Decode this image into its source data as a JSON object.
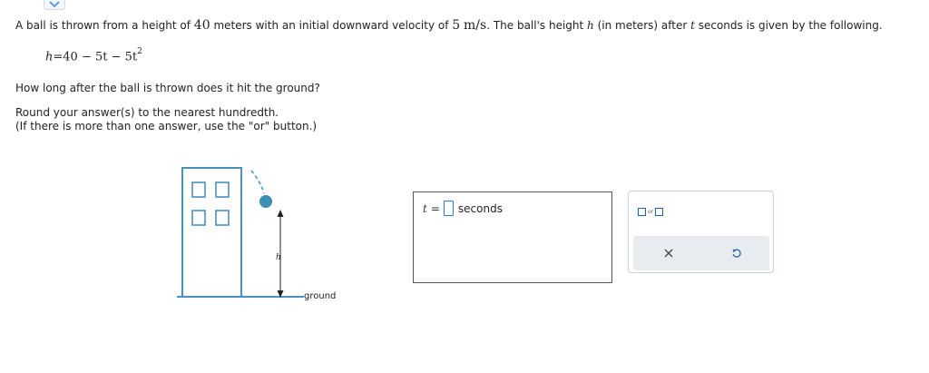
{
  "problem": {
    "intro_1": "A ball is thrown from a height of ",
    "height_value": "40",
    "intro_2": " meters with an initial downward velocity of ",
    "velocity_value": "5",
    "velocity_unit": "m/s",
    "intro_3": ". The ball's height ",
    "h_var": "h",
    "intro_4": " (in meters) after ",
    "t_var": "t",
    "intro_5": " seconds is given by the following."
  },
  "formula": {
    "lhs": "h",
    "rhs": "=40 − 5t − 5t",
    "exponent": "2"
  },
  "question": "How long after the ball is thrown does it hit the ground?",
  "instructions": {
    "line1": "Round your answer(s) to the nearest hundredth.",
    "line2": "(If there is more than one answer, use the \"or\" button.)"
  },
  "diagram": {
    "h_label": "h",
    "ground_label": "ground"
  },
  "answer": {
    "variable": "t",
    "equals": "=",
    "value": "",
    "units": "seconds"
  },
  "tools": {
    "or_label": "or"
  },
  "colors": {
    "building": "#4a8fc2",
    "ball": "#3d8fb3",
    "input_border": "#2b7bd6",
    "tool_bar": "#e8ecf0"
  }
}
